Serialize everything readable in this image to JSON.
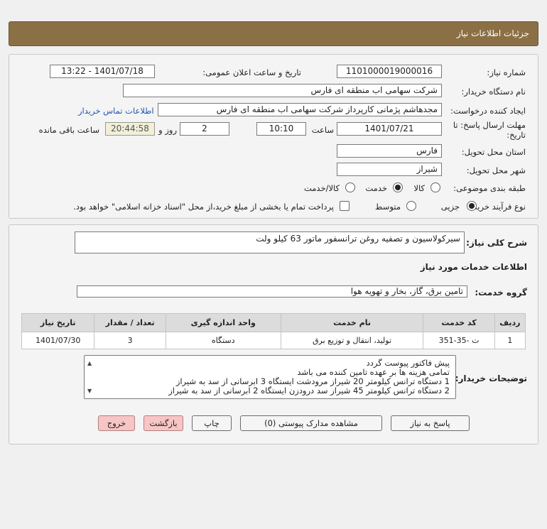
{
  "header": {
    "title": "جزئیات اطلاعات نیاز"
  },
  "form": {
    "need_number_label": "شماره نیاز:",
    "need_number": "1101000019000016",
    "announce_label": "تاریخ و ساعت اعلان عمومی:",
    "announce_value": "1401/07/18 - 13:22",
    "buyer_org_label": "نام دستگاه خریدار:",
    "buyer_org": "شرکت سهامی اب منطقه ای فارس",
    "requester_label": "ایجاد کننده درخواست:",
    "requester": "مجدهاشم پژمانی کارپرداز شرکت سهامی اب منطقه ای فارس",
    "contact_link": "اطلاعات تماس خریدار",
    "deadline_label_1": "مهلت ارسال پاسخ: تا",
    "deadline_label_2": "تاریخ:",
    "deadline_date": "1401/07/21",
    "time_label": "ساعت",
    "deadline_time": "10:10",
    "days_value": "2",
    "days_label": "روز و",
    "remaining_time": "20:44:58",
    "remaining_label": "ساعت باقی مانده",
    "province_label": "استان محل تحویل:",
    "province": "فارس",
    "city_label": "شهر محل تحویل:",
    "city": "شیراز",
    "category_label": "طبقه بندی موضوعی:",
    "category_options": [
      "کالا",
      "خدمت",
      "کالا/خدمت"
    ],
    "category_selected": "خدمت",
    "process_label": "نوع فرآیند خرید :",
    "process_options": [
      "جزیی",
      "متوسط"
    ],
    "process_selected": "جزیی",
    "payment_note": "پرداخت تمام یا بخشی از مبلغ خرید،از محل \"اسناد خزانه اسلامی\" خواهد بود."
  },
  "details": {
    "summary_label": "شرح کلی نیاز:",
    "summary": "سیرکولاسیون و تصفیه روغن ترانسفور ماتور 63 کیلو ولت",
    "services_heading": "اطلاعات خدمات مورد نیاز",
    "service_group_label": "گروه خدمت:",
    "service_group": "تامین برق، گاز، بخار و تهویه هوا",
    "table": {
      "headers": [
        "ردیف",
        "کد خدمت",
        "نام خدمت",
        "واحد اندازه گیری",
        "تعداد / مقدار",
        "تاریخ نیاز"
      ],
      "rows": [
        [
          "1",
          "ت -35-351",
          "تولید، انتقال و توزیع برق",
          "دستگاه",
          "3",
          "1401/07/30"
        ]
      ]
    },
    "notes_label": "توضیحات خریدار:",
    "notes": [
      "پیش فاکتور پیوست گردد",
      "تمامی هزینه ها بر عهده تامین کننده می باشد",
      "1 دستگاه ترانس کیلومتر 20 شیراز مرودشت ایستگاه 3 ابرسانی از سد به شیراز",
      "2 دستگاه ترانس کیلومتر 45 شیراز سد درودزن ایستگاه 2 ابرسانی از سد به شیراز"
    ]
  },
  "buttons": {
    "reply": "پاسخ به نیاز",
    "docs": "مشاهده مدارک پیوستی (0)",
    "print": "چاپ",
    "back": "بازگشت",
    "exit": "خروج"
  },
  "icons": {
    "scroll_up": "chevron-up-icon",
    "scroll_down": "chevron-down-icon"
  }
}
